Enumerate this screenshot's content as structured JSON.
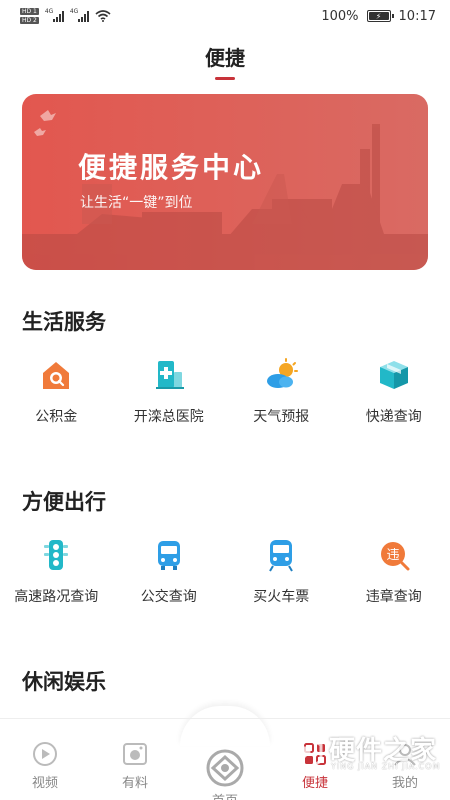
{
  "status_bar": {
    "sim1": "HD 1",
    "sim2": "HD 2",
    "net1": "4G",
    "net2": "4G",
    "battery_percent": "100%",
    "battery_level": 1.0,
    "time": "10:17"
  },
  "header": {
    "title": "便捷"
  },
  "banner": {
    "title": "便捷服务中心",
    "subtitle": "让生活“一键”到位"
  },
  "sections": [
    {
      "title": "生活服务",
      "items": [
        {
          "label": "公积金",
          "icon": "housing-fund-icon"
        },
        {
          "label": "开滦总医院",
          "icon": "hospital-icon"
        },
        {
          "label": "天气预报",
          "icon": "weather-icon"
        },
        {
          "label": "快递查询",
          "icon": "package-icon"
        }
      ]
    },
    {
      "title": "方便出行",
      "items": [
        {
          "label": "高速路况查询",
          "icon": "traffic-light-icon"
        },
        {
          "label": "公交查询",
          "icon": "bus-icon"
        },
        {
          "label": "买火车票",
          "icon": "train-icon"
        },
        {
          "label": "违章查询",
          "icon": "violation-icon"
        }
      ]
    },
    {
      "title": "休闲娱乐",
      "items": []
    }
  ],
  "tabbar": {
    "tabs": [
      {
        "label": "视频",
        "icon": "video-play-icon"
      },
      {
        "label": "有料",
        "icon": "camera-icon"
      },
      {
        "label": "首页",
        "icon": "home-logo-icon"
      },
      {
        "label": "便捷",
        "icon": "grid-apps-icon",
        "active": true
      },
      {
        "label": "我的",
        "icon": "profile-icon"
      }
    ]
  },
  "watermark": {
    "main": "硬件之家",
    "sub": "YING JIAN ZHI JIA.COM"
  },
  "colors": {
    "accent": "#c8333a",
    "banner": "#e2574f",
    "icon_blue": "#2e9ee6",
    "icon_orange": "#f07a3a"
  }
}
